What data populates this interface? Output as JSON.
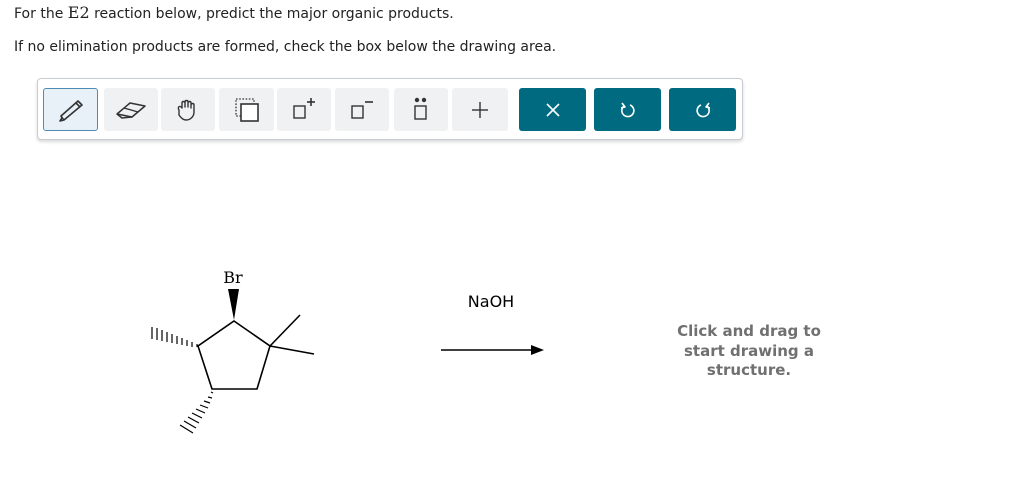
{
  "instructions": {
    "line1_prefix": "For the ",
    "line1_reaction": "E2",
    "line1_suffix": " reaction below, predict the major organic products.",
    "line2": "If no elimination products are formed, check the box below the drawing area."
  },
  "toolbar": {
    "tools": [
      {
        "name": "pencil-tool",
        "icon": "pencil-icon",
        "state": "selected"
      },
      {
        "name": "eraser-tool",
        "icon": "eraser-icon"
      },
      {
        "name": "hand-tool",
        "icon": "hand-icon"
      },
      {
        "name": "select-tool",
        "icon": "dotted-select-icon"
      },
      {
        "name": "positive-charge-tool",
        "icon": "box-plus-charge-icon"
      },
      {
        "name": "negative-charge-tool",
        "icon": "box-minus-charge-icon"
      },
      {
        "name": "lone-pair-tool",
        "icon": "box-lone-pair-icon"
      },
      {
        "name": "add-tool",
        "icon": "plus-icon"
      }
    ],
    "actions": [
      {
        "name": "clear",
        "icon": "close-icon"
      },
      {
        "name": "undo",
        "icon": "undo-icon"
      },
      {
        "name": "redo",
        "icon": "redo-icon"
      }
    ],
    "accent_color": "#006b80"
  },
  "reaction": {
    "substituent_label": "Br",
    "reagent": "NaOH"
  },
  "drawing_area": {
    "placeholder_line1": "Click and drag to",
    "placeholder_line2": "start drawing a",
    "placeholder_line3": "structure."
  }
}
